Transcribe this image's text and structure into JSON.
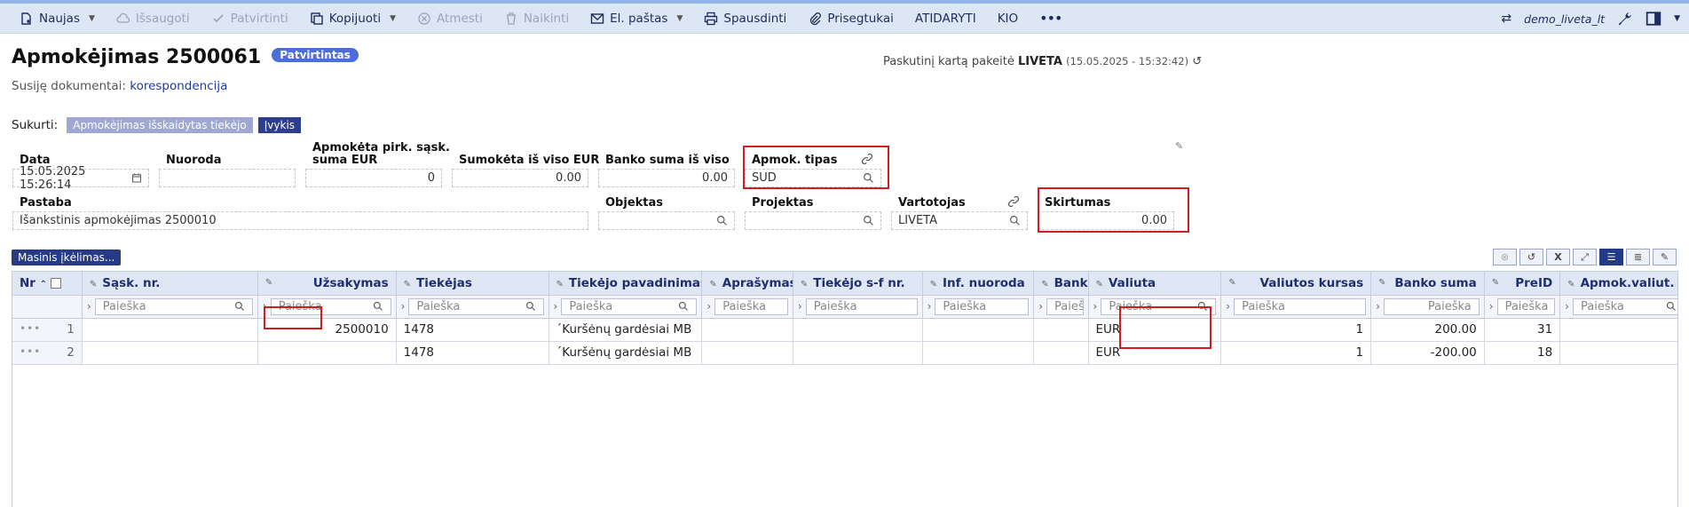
{
  "toolbar": {
    "new": "Naujas",
    "save": "Išsaugoti",
    "confirm": "Patvirtinti",
    "copy": "Kopijuoti",
    "cancel": "Atmesti",
    "delete": "Naikinti",
    "email": "El. paštas",
    "print": "Spausdinti",
    "attachments": "Prisegtukai",
    "open": "ATIDARYTI",
    "kio": "KIO",
    "more": "•••",
    "user": "demo_liveta_lt"
  },
  "header": {
    "title": "Apmokėjimas 2500061",
    "status": "Patvirtintas",
    "last_changed_label": "Paskutinį kartą pakeitė",
    "last_changed_user": "LIVETA",
    "last_changed_time": "(15.05.2025 - 15:32:42)"
  },
  "related": {
    "label": "Susiję dokumentai:",
    "link": "korespondencija"
  },
  "create": {
    "label": "Sukurti:",
    "chip1": "Apmokėjimas išskaidytas tiekėjo",
    "chip2": "Įvykis"
  },
  "form": {
    "data_label": "Data",
    "data_value": "15.05.2025 15:26:14",
    "nuoroda_label": "Nuoroda",
    "nuoroda_value": "",
    "apm_pirk_label1": "Apmokėta pirk. sąsk.",
    "apm_pirk_label2": "suma EUR",
    "apm_pirk_value": "0",
    "sumoketa_label": "Sumokėta iš viso EUR",
    "sumoketa_value": "0.00",
    "banko_label": "Banko suma iš viso",
    "banko_value": "0.00",
    "tipas_label": "Apmok. tipas",
    "tipas_value": "SUD",
    "pastaba_label": "Pastaba",
    "pastaba_value": "Išankstinis apmokėjimas 2500010",
    "objektas_label": "Objektas",
    "projektas_label": "Projektas",
    "vartotojas_label": "Vartotojas",
    "vartotojas_value": "LIVETA",
    "skirtumas_label": "Skirtumas",
    "skirtumas_value": "0.00"
  },
  "grid": {
    "mass_import": "Masinis įkėlimas...",
    "search_placeholder": "Paieška",
    "columns": [
      "Nr",
      "Sąsk. nr.",
      "Užsakymas",
      "Tiekėjas",
      "Tiekėjo pavadinimas",
      "Aprašymas",
      "Tiekėjo s-f nr.",
      "Inf. nuoroda",
      "Bank",
      "Valiuta",
      "Valiutos kursas",
      "Banko suma",
      "PreID",
      "Apmok.valiut."
    ],
    "rows": [
      {
        "nr": "1",
        "sask": "",
        "uzsakymas": "2500010",
        "tiekejas": "1478",
        "pavadinimas": "´Kuršėnų gardėsiai MB",
        "aprasymas": "",
        "sf": "",
        "inf": "",
        "bank": "",
        "valiuta": "EUR",
        "kursas": "1",
        "banko_suma": "200.00",
        "preid": "31",
        "apm_val": ""
      },
      {
        "nr": "2",
        "sask": "",
        "uzsakymas": "",
        "tiekejas": "1478",
        "pavadinimas": "´Kuršėnų gardėsiai MB",
        "aprasymas": "",
        "sf": "",
        "inf": "",
        "bank": "",
        "valiuta": "EUR",
        "kursas": "1",
        "banko_suma": "-200.00",
        "preid": "18",
        "apm_val": ""
      }
    ]
  }
}
